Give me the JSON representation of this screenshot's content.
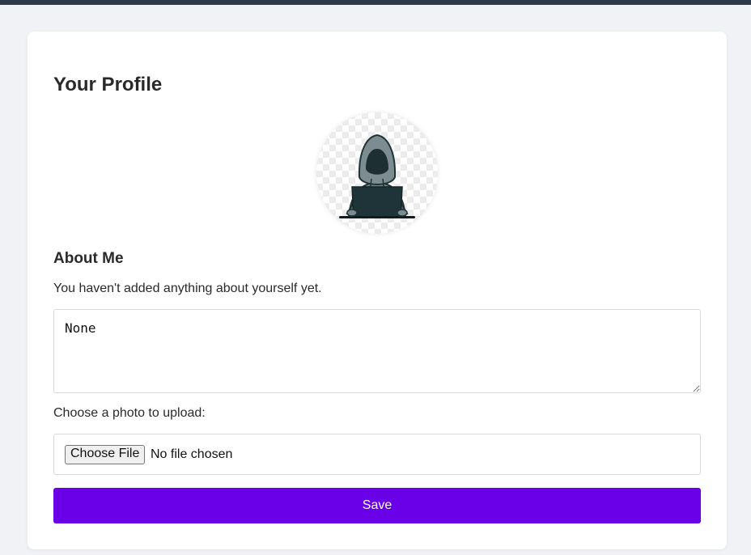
{
  "profile": {
    "title": "Your Profile",
    "avatar_icon": "hooded-figure-laptop-icon"
  },
  "about": {
    "heading": "About Me",
    "empty_message": "You haven't added anything about yourself yet.",
    "textarea_value": "None"
  },
  "upload": {
    "label": "Choose a photo to upload:",
    "button_label": "Choose File",
    "status": "No file chosen"
  },
  "actions": {
    "save_label": "Save"
  },
  "colors": {
    "accent": "#6a00e8",
    "topbar": "#2c3a4a",
    "background": "#f1f2f6"
  }
}
